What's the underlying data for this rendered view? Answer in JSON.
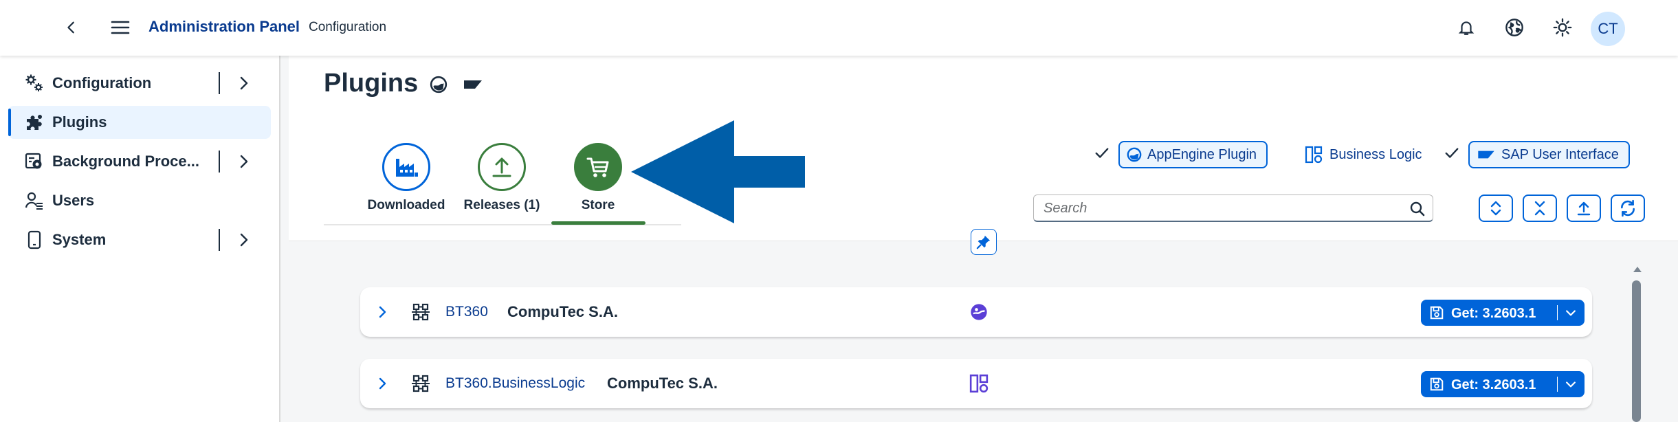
{
  "header": {
    "title": "Administration Panel",
    "subtitle": "Configuration",
    "avatar_initials": "CT"
  },
  "sidebar": {
    "items": [
      {
        "label": "Configuration",
        "icon": "gears-icon",
        "expandable": true
      },
      {
        "label": "Plugins",
        "icon": "puzzle-icon",
        "expandable": false,
        "active": true
      },
      {
        "label": "Background Proce...",
        "icon": "background-process-icon",
        "expandable": true
      },
      {
        "label": "Users",
        "icon": "user-list-icon",
        "expandable": false
      },
      {
        "label": "System",
        "icon": "tablet-icon",
        "expandable": true
      }
    ]
  },
  "page": {
    "title": "Plugins",
    "tabs": [
      {
        "label": "Downloaded",
        "icon": "factory-icon",
        "color": "#0064d9"
      },
      {
        "label": "Releases (1)",
        "icon": "upload-icon",
        "color": "#3a7e3d"
      },
      {
        "label": "Store",
        "icon": "cart-icon",
        "color": "#3a7e3d",
        "active": true
      }
    ],
    "filters": [
      {
        "label": "AppEngine Plugin",
        "selected": true,
        "icon": "appengine-icon"
      },
      {
        "label": "Business Logic",
        "selected": false,
        "icon": "business-logic-icon"
      },
      {
        "label": "SAP User Interface",
        "selected": true,
        "icon": "sap-ui-icon"
      }
    ],
    "search": {
      "placeholder": "Search",
      "value": ""
    }
  },
  "plugins": [
    {
      "id": "BT360",
      "vendor": "CompuTec S.A.",
      "type_icon": "appengine-icon",
      "action": "Get: 3.2603.1"
    },
    {
      "id": "BT360.BusinessLogic",
      "vendor": "CompuTec S.A.",
      "type_icon": "business-logic-icon",
      "action": "Get: 3.2603.1"
    }
  ],
  "colors": {
    "accent": "#0064d9",
    "link": "#0a3b8f",
    "success": "#3a7e3d",
    "arrow": "#005ea8",
    "type_icon": "#5b3fd6"
  }
}
